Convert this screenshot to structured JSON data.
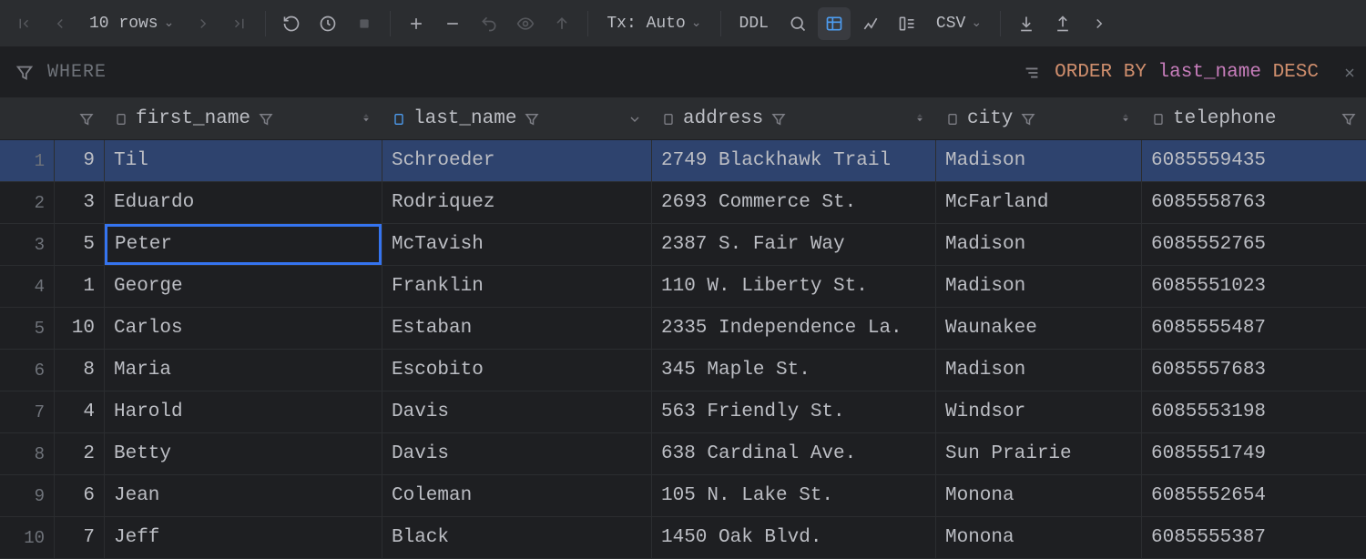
{
  "toolbar": {
    "rows_label": "10 rows",
    "tx_label": "Tx: Auto",
    "ddl_label": "DDL",
    "csv_label": "CSV"
  },
  "filters": {
    "where_label": "WHERE",
    "order_kw": "ORDER BY",
    "order_col": "last_name",
    "order_dir": "DESC"
  },
  "columns": {
    "first_name": "first_name",
    "last_name": "last_name",
    "address": "address",
    "city": "city",
    "telephone": "telephone"
  },
  "editing": {
    "row": 3,
    "field": "first_name",
    "value": "Peter"
  },
  "selected_row": 1,
  "rows": [
    {
      "n": "1",
      "id": "9",
      "first_name": "Til",
      "last_name": "Schroeder",
      "address": "2749 Blackhawk Trail",
      "city": "Madison",
      "telephone": "6085559435"
    },
    {
      "n": "2",
      "id": "3",
      "first_name": "Eduardo",
      "last_name": "Rodriquez",
      "address": "2693 Commerce St.",
      "city": "McFarland",
      "telephone": "6085558763"
    },
    {
      "n": "3",
      "id": "5",
      "first_name": "Peter",
      "last_name": "McTavish",
      "address": "2387 S. Fair Way",
      "city": "Madison",
      "telephone": "6085552765"
    },
    {
      "n": "4",
      "id": "1",
      "first_name": "George",
      "last_name": "Franklin",
      "address": "110 W. Liberty St.",
      "city": "Madison",
      "telephone": "6085551023"
    },
    {
      "n": "5",
      "id": "10",
      "first_name": "Carlos",
      "last_name": "Estaban",
      "address": "2335 Independence La.",
      "city": "Waunakee",
      "telephone": "6085555487"
    },
    {
      "n": "6",
      "id": "8",
      "first_name": "Maria",
      "last_name": "Escobito",
      "address": "345 Maple St.",
      "city": "Madison",
      "telephone": "6085557683"
    },
    {
      "n": "7",
      "id": "4",
      "first_name": "Harold",
      "last_name": "Davis",
      "address": "563 Friendly St.",
      "city": "Windsor",
      "telephone": "6085553198"
    },
    {
      "n": "8",
      "id": "2",
      "first_name": "Betty",
      "last_name": "Davis",
      "address": "638 Cardinal Ave.",
      "city": "Sun Prairie",
      "telephone": "6085551749"
    },
    {
      "n": "9",
      "id": "6",
      "first_name": "Jean",
      "last_name": "Coleman",
      "address": "105 N. Lake St.",
      "city": "Monona",
      "telephone": "6085552654"
    },
    {
      "n": "10",
      "id": "7",
      "first_name": "Jeff",
      "last_name": "Black",
      "address": "1450 Oak Blvd.",
      "city": "Monona",
      "telephone": "6085555387"
    }
  ]
}
